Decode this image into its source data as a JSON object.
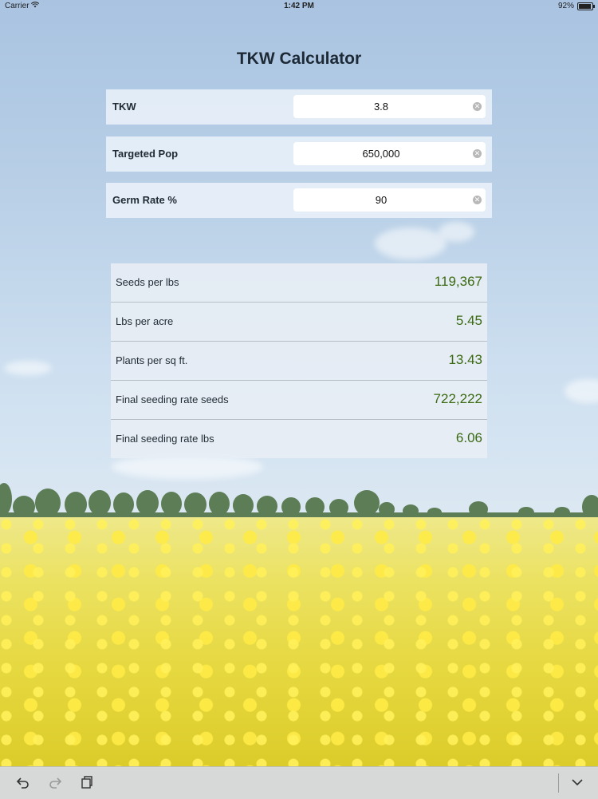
{
  "status_bar": {
    "carrier": "Carrier",
    "time": "1:42 PM",
    "battery_percent": "92%",
    "battery_level": 0.92
  },
  "app": {
    "title": "TKW Calculator"
  },
  "inputs": [
    {
      "label": "TKW",
      "value": "3.8"
    },
    {
      "label": "Targeted Pop",
      "value": "650,000"
    },
    {
      "label": "Germ Rate %",
      "value": "90"
    }
  ],
  "results": [
    {
      "label": "Seeds per lbs",
      "value": "119,367"
    },
    {
      "label": "Lbs per acre",
      "value": "5.45"
    },
    {
      "label": "Plants per sq ft.",
      "value": "13.43"
    },
    {
      "label": "Final seeding rate seeds",
      "value": "722,222"
    },
    {
      "label": "Final seeding rate lbs",
      "value": "6.06"
    }
  ],
  "toolbar": {
    "undo_icon": "undo-icon",
    "redo_icon": "redo-icon",
    "clipboard_icon": "clipboard-icon",
    "dismiss_keyboard_icon": "chevron-down-icon"
  },
  "colors": {
    "result_value": "#3b6a12",
    "title": "#1d2a36",
    "toolbar_bg": "#d7d9d9"
  }
}
